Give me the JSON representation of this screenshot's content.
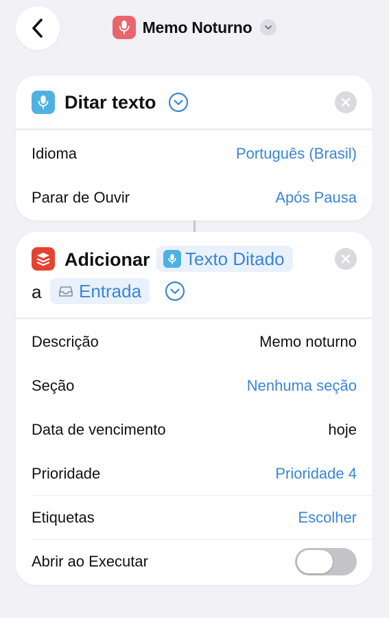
{
  "header": {
    "title": "Memo Noturno",
    "back_icon": "chevron-left-icon",
    "app_icon": "microphone-icon",
    "app_icon_color": "#e8656d"
  },
  "dictate_action": {
    "title": "Ditar texto",
    "icon": "microphone-icon",
    "icon_color": "#4fb1e3",
    "rows": [
      {
        "label": "Idioma",
        "value": "Português (Brasil)"
      },
      {
        "label": "Parar de Ouvir",
        "value": "Após Pausa"
      }
    ]
  },
  "todoist_action": {
    "verb": "Adicionar",
    "variable_token": "Texto Ditado",
    "preposition": "a",
    "project_token": "Entrada",
    "icon": "todoist-icon",
    "icon_color": "#e44332",
    "rows": [
      {
        "label": "Descrição",
        "value": "Memo noturno"
      },
      {
        "label": "Seção",
        "value": "Nenhuma seção"
      },
      {
        "label": "Data de vencimento",
        "value": "hoje"
      },
      {
        "label": "Prioridade",
        "value": "Prioridade 4"
      },
      {
        "label": "Etiquetas",
        "value": "Escolher"
      },
      {
        "label": "Abrir ao Executar",
        "toggle_on": false
      }
    ]
  },
  "colors": {
    "accent": "#3a85d8",
    "background": "#f1f1f6"
  }
}
